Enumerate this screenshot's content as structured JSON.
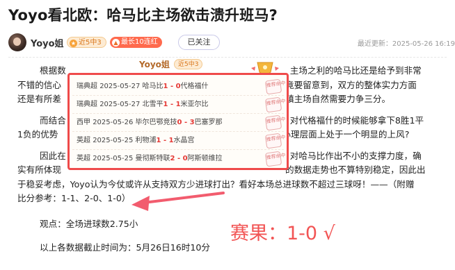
{
  "title": "Yoyo看北欧：哈马比主场欲击溃升班马?",
  "author": {
    "name": "Yoyo姐",
    "badges": [
      "近5中3",
      "最长10连红"
    ],
    "follow_label": "已关注"
  },
  "updated": "最近更新：2025-05-26 16:19",
  "article": {
    "paragraph_1_prefix": "根据数",
    "paragraph_1_suffix": "主场之利的哈马比还是给予到非常",
    "paragraph_1_line2_prefix": "不错的信心",
    "paragraph_1_line2_suffix": "竟要留意到，双方的整体实力方面",
    "paragraph_1_line3_prefix": "还是有所差",
    "paragraph_1_line3_suffix": "镇主场自然需要力争三分。",
    "paragraph_2_prefix": "而结合",
    "paragraph_2_suffix": "对代格福什的时候能够拿下8胜1平",
    "paragraph_2_line2_prefix": "1负的优势",
    "paragraph_2_line2_suffix": "心理层面上处于一个明显的上风?",
    "paragraph_3_prefix": "因此在",
    "paragraph_3_suffix": "对哈马比作出不小的支撑力度，确",
    "paragraph_3_line2_prefix": "实有所体现",
    "paragraph_3_line2_suffix": "的数据走势也不算特别稳定，因此出",
    "paragraph_3_line3": "于稳妥考虑，Yoyo认为今仗或许从支持双方少进球打出？看好本场总进球数不超过三球呀！——（附赠",
    "paragraph_3_line4": "比分参考：1-1、2-0、1-0）",
    "viewpoint": "观点：全场进球数2.75小",
    "cutoff": "以上各数据截止时间为：5月26日16时10分"
  },
  "popup": {
    "title": "Yoyo姐",
    "badge": "近5中3",
    "stamp": "推荐命中",
    "matches": [
      {
        "league": "瑞典超",
        "date": "2025-05-27",
        "home": "哈马比",
        "score": "1 - 0",
        "away": "代格福什"
      },
      {
        "league": "瑞典超",
        "date": "2025-05-27",
        "home": "北雪平",
        "score": "1 - 1",
        "away": "米亚尔比"
      },
      {
        "league": "西甲",
        "date": "2025-05-26",
        "home": "毕尔巴鄂竞技",
        "score": "0 - 3",
        "away": "巴塞罗那"
      },
      {
        "league": "英超",
        "date": "2025-05-25",
        "home": "利物浦",
        "score": "1 - 1",
        "away": "水晶宫"
      },
      {
        "league": "英超",
        "date": "2025-05-25",
        "home": "曼彻斯特联",
        "score": "2 - 0",
        "away": "阿斯顿维拉"
      }
    ]
  },
  "result": "赛果：1-0 √",
  "colors": {
    "accent_red": "#ef4a4a",
    "score_red": "#e53935",
    "badge_orange": "#f7a33a"
  }
}
